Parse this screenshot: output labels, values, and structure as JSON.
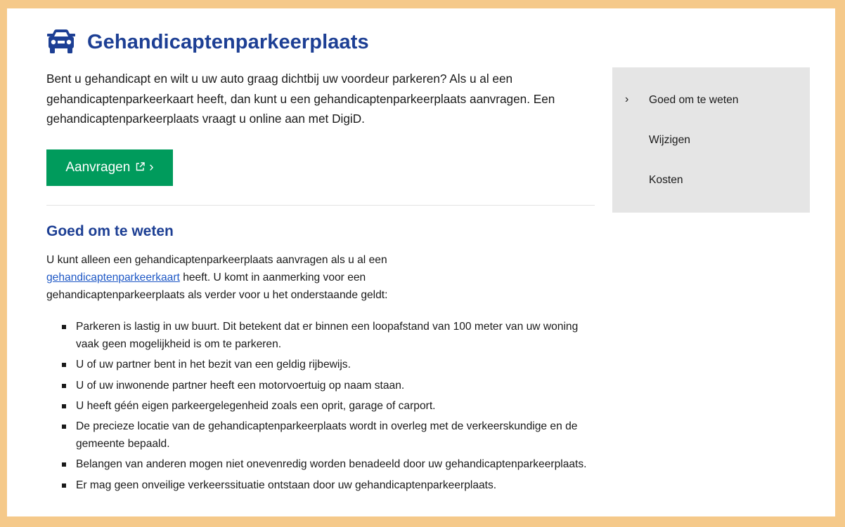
{
  "page": {
    "title": "Gehandicaptenparkeerplaats",
    "title_icon": "car-icon",
    "intro": "Bent u gehandicapt en wilt u uw auto graag dichtbij uw voordeur parkeren? Als u al een gehandicaptenparkeerkaart heeft, dan kunt u een gehandicaptenparkeerplaats aanvragen. Een gehandicaptenparkeerplaats vraagt u online aan met DigiD."
  },
  "cta": {
    "label": "Aanvragen",
    "external_icon": "external-link-icon",
    "chevron": "›"
  },
  "section": {
    "title": "Goed om te weten",
    "body_before_link": "U kunt alleen een gehandicaptenparkeerplaats aanvragen als u al een ",
    "link_text": "gehandicaptenparkeerkaart",
    "body_after_link": " heeft. U komt in aanmerking voor een gehandicaptenparkeerplaats als verder voor u het onderstaande geldt:",
    "bullets": [
      "Parkeren is lastig in uw buurt. Dit betekent dat er binnen een loopafstand van 100 meter van uw woning vaak geen mogelijkheid is om te parkeren.",
      "U of uw partner bent in het bezit van een geldig rijbewijs.",
      "U of uw inwonende partner heeft een motorvoertuig op naam staan.",
      "U heeft géén eigen parkeergelegenheid zoals een oprit, garage of carport.",
      "De precieze locatie van de gehandicaptenparkeerplaats wordt in overleg met de verkeerskundige en de gemeente bepaald.",
      "Belangen van anderen mogen niet onevenredig worden benadeeld door uw gehandicaptenparkeerplaats.",
      "Er mag geen onveilige verkeerssituatie ontstaan door uw gehandicaptenparkeerplaats."
    ]
  },
  "sidenav": {
    "active_marker": "›",
    "items": [
      {
        "label": "Goed om te weten"
      },
      {
        "label": "Wijzigen"
      },
      {
        "label": "Kosten"
      }
    ]
  },
  "colors": {
    "title_blue": "#1d3f94",
    "cta_green": "#009b5c",
    "border_orange": "#f5c98a",
    "sidebar_gray": "#e5e5e5",
    "link_blue": "#1d57c5"
  }
}
